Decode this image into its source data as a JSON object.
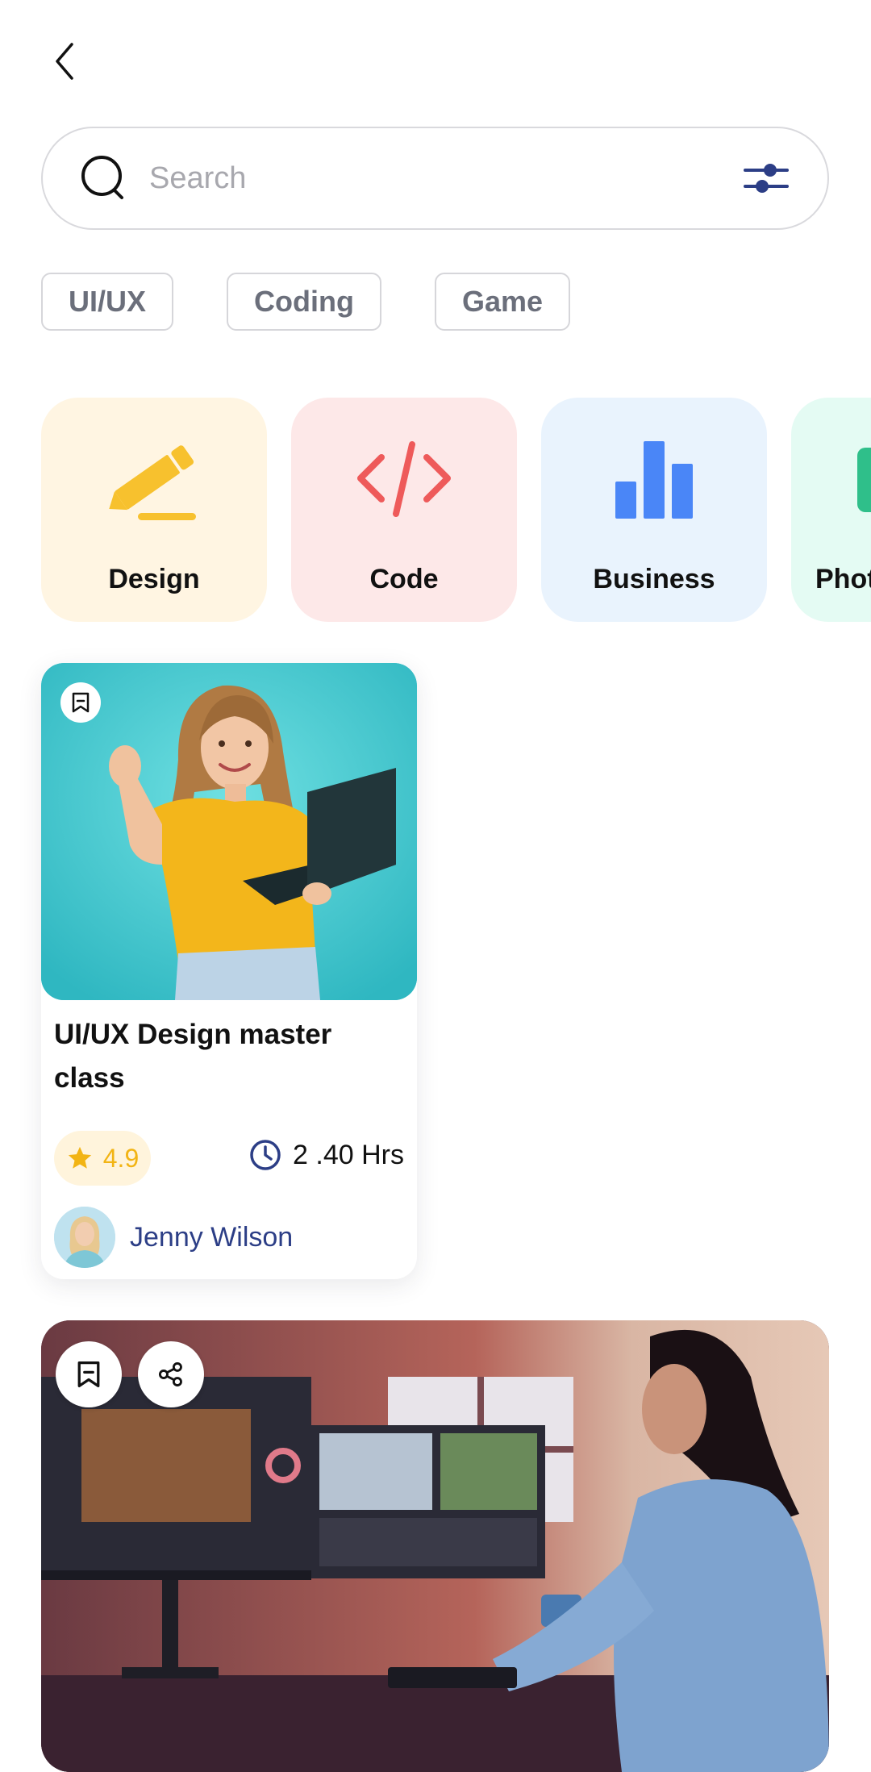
{
  "header": {
    "back_icon": "chevron-left-icon"
  },
  "search": {
    "placeholder": "Search",
    "value": "",
    "search_icon": "search-icon",
    "filter_icon": "sliders-icon"
  },
  "chips": [
    {
      "label": "UI/UX"
    },
    {
      "label": "Coding"
    },
    {
      "label": "Game"
    }
  ],
  "categories": [
    {
      "label": "Design",
      "icon": "pencil-icon",
      "color": "#f7c12e",
      "bg": "#fff5e2"
    },
    {
      "label": "Code",
      "icon": "code-icon",
      "color": "#ee5a5a",
      "bg": "#fde8e8"
    },
    {
      "label": "Business",
      "icon": "bar-chart-icon",
      "color": "#4a86f7",
      "bg": "#e9f3fd"
    },
    {
      "label": "Photo",
      "icon": "camera-icon",
      "color": "#2fbf8a",
      "bg": "#e4fbf3"
    }
  ],
  "courses": [
    {
      "title": "UI/UX Design master class",
      "rating": "4.9",
      "duration": "2 .40 Hrs",
      "author": "Jenny Wilson",
      "bookmark_icon": "bookmark-icon",
      "rating_icon": "star-icon",
      "duration_icon": "clock-icon"
    },
    {
      "bookmark_icon": "bookmark-icon",
      "share_icon": "share-icon"
    }
  ],
  "colors": {
    "accent": "#2c3e86",
    "star": "#f2b414",
    "chip_text": "#6b6f7b"
  }
}
